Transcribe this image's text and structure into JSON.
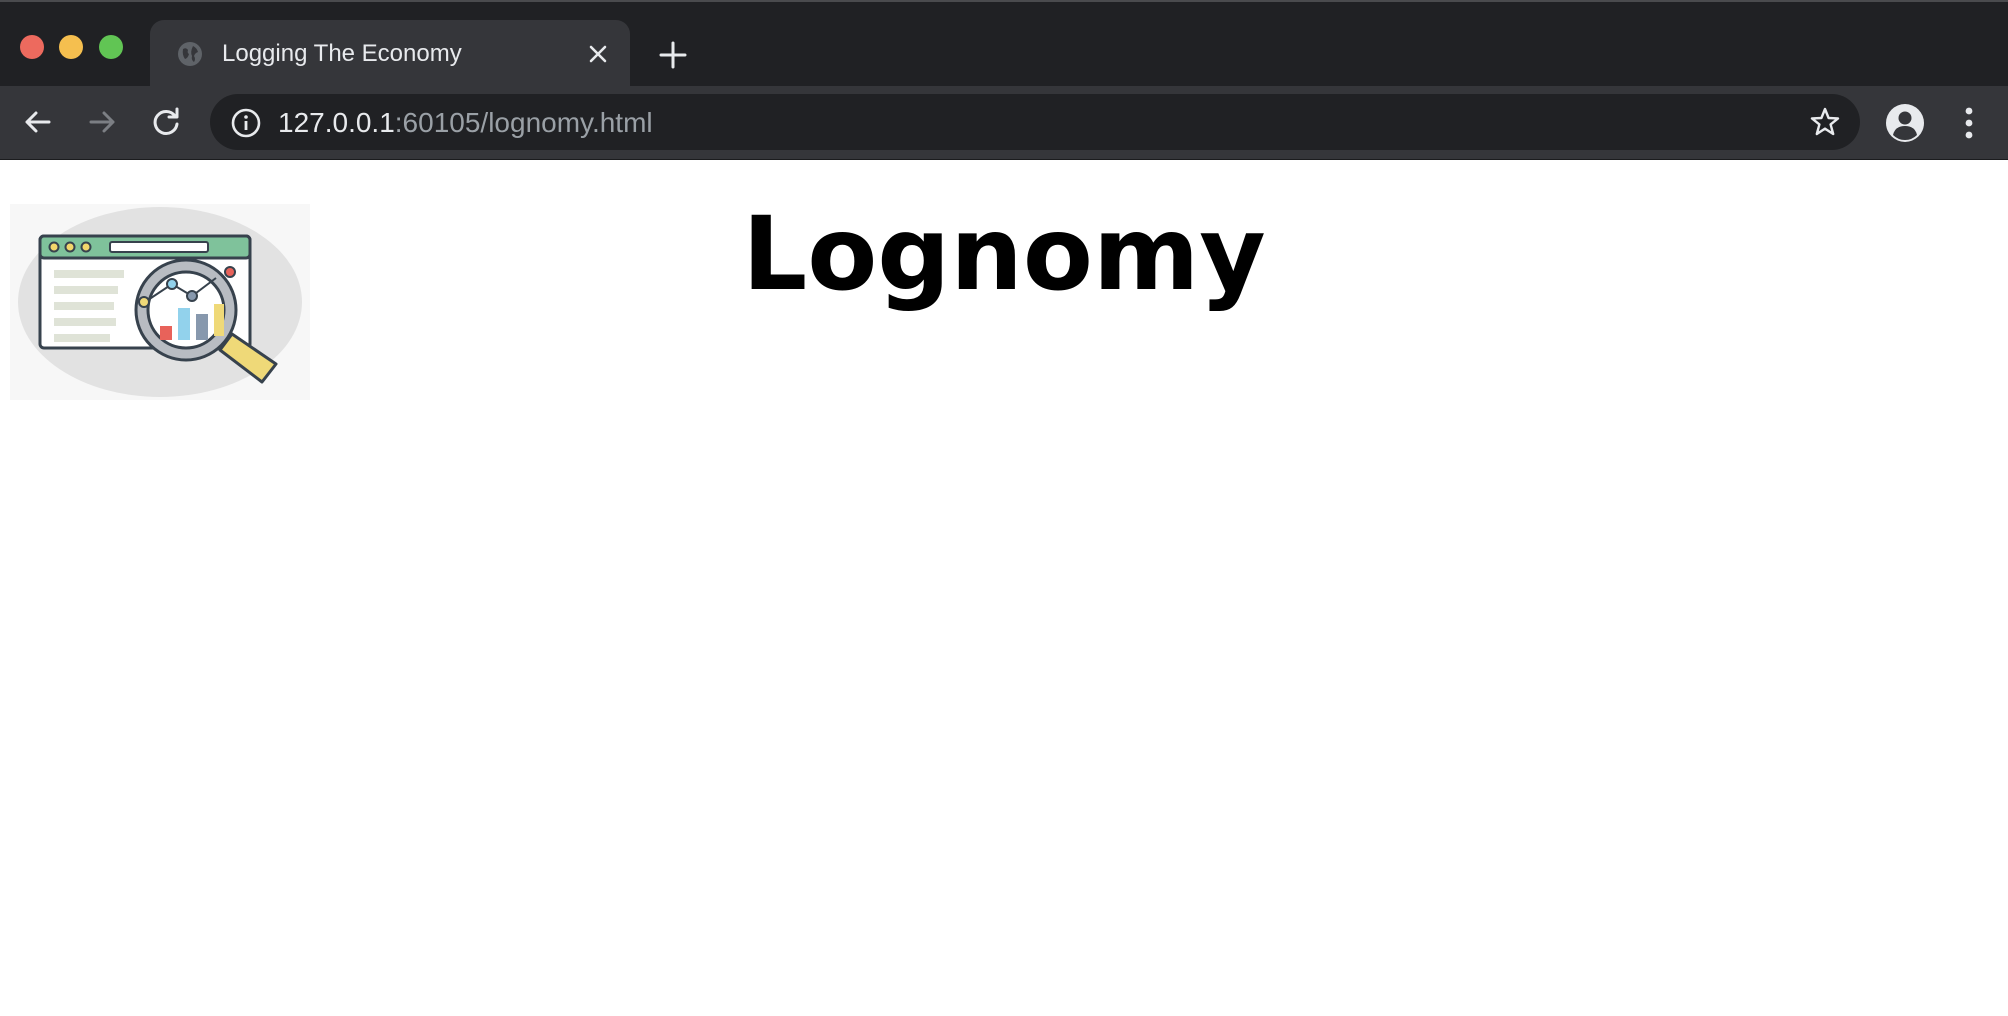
{
  "window": {
    "tab_title": "Logging The Economy"
  },
  "address_bar": {
    "url_host": "127.0.0.1",
    "url_rest": ":60105/lognomy.html"
  },
  "page": {
    "heading": "Lognomy",
    "logo_icon": "analytics-magnifier-icon"
  },
  "colors": {
    "chrome_dark": "#202124",
    "chrome_toolbar": "#35363a",
    "page_background": "#ffffff",
    "traffic_close": "#ed6a5e",
    "traffic_minimize": "#f5bf4f",
    "traffic_maximize": "#61c554"
  }
}
